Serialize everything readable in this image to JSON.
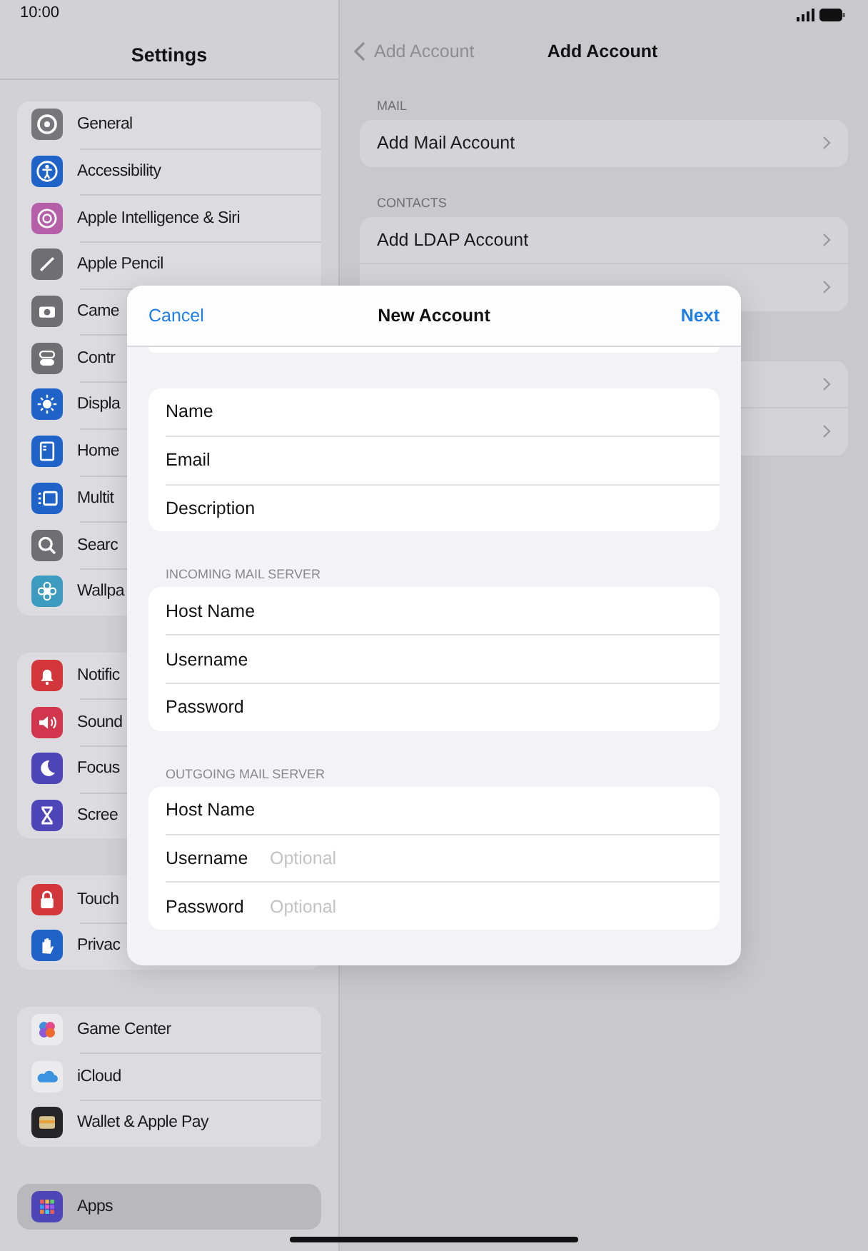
{
  "status_bar": {
    "time": "10:00"
  },
  "sidebar": {
    "title": "Settings",
    "groups": [
      {
        "items": [
          {
            "label": "General",
            "selected": false
          },
          {
            "label": "Accessibility",
            "selected": false
          },
          {
            "label": "Apple Intelligence & Siri",
            "selected": false
          },
          {
            "label": "Apple Pencil",
            "selected": false
          },
          {
            "label": "Came",
            "selected": false
          },
          {
            "label": "Contr",
            "selected": false
          },
          {
            "label": "Displa",
            "selected": false
          },
          {
            "label": "Home",
            "selected": false
          },
          {
            "label": "Multit",
            "selected": false
          },
          {
            "label": "Searc",
            "selected": false
          },
          {
            "label": "Wallpa",
            "selected": false
          }
        ]
      },
      {
        "items": [
          {
            "label": "Notific",
            "selected": false
          },
          {
            "label": "Sound",
            "selected": false
          },
          {
            "label": "Focus",
            "selected": false
          },
          {
            "label": "Scree",
            "selected": false
          }
        ]
      },
      {
        "items": [
          {
            "label": "Touch",
            "selected": false
          },
          {
            "label": "Privac",
            "selected": false
          }
        ]
      },
      {
        "items": [
          {
            "label": "Game Center",
            "selected": false
          },
          {
            "label": "iCloud",
            "selected": false
          },
          {
            "label": "Wallet & Apple Pay",
            "selected": false
          }
        ]
      },
      {
        "items": [
          {
            "label": "Apps",
            "selected": true
          }
        ]
      }
    ]
  },
  "detail": {
    "back": "Add Account",
    "title": "Add Account",
    "sections": [
      {
        "header": "MAIL",
        "rows": [
          {
            "label": "Add Mail Account",
            "chevron": true
          }
        ]
      },
      {
        "header": "CONTACTS",
        "rows": [
          {
            "label": "Add LDAP Account",
            "chevron": true
          },
          {
            "chevron": true
          }
        ]
      },
      {
        "rows": [
          {
            "chevron": true
          },
          {
            "chevron": true
          }
        ]
      }
    ]
  },
  "dialog": {
    "cancel": "Cancel",
    "title": "New Account",
    "next": "Next",
    "sections": [
      {
        "fields": [
          {
            "label": "Name"
          },
          {
            "label": "Email"
          },
          {
            "label": "Description"
          }
        ]
      },
      {
        "header": "INCOMING MAIL SERVER",
        "fields": [
          {
            "label": "Host Name"
          },
          {
            "label": "Username"
          },
          {
            "label": "Password"
          }
        ]
      },
      {
        "header": "OUTGOING MAIL SERVER",
        "fields": [
          {
            "label": "Host Name"
          },
          {
            "label": "Username",
            "placeholder": "Optional"
          },
          {
            "label": "Password",
            "placeholder": "Optional"
          }
        ]
      }
    ]
  }
}
